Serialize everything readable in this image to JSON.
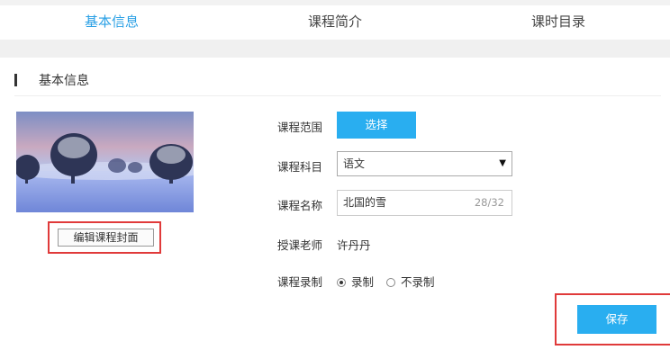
{
  "tabs": [
    {
      "label": "基本信息",
      "active": true
    },
    {
      "label": "课程简介",
      "active": false
    },
    {
      "label": "课时目录",
      "active": false
    }
  ],
  "section": {
    "title": "基本信息"
  },
  "cover": {
    "edit_label": "编辑课程封面"
  },
  "form": {
    "range_label": "课程范围",
    "range_button": "选择",
    "subject_label": "课程科目",
    "subject_value": "语文",
    "name_label": "课程名称",
    "name_value": "北国的雪",
    "name_counter": "28/32",
    "teacher_label": "授课老师",
    "teacher_value": "许丹丹",
    "record_label": "课程录制",
    "record_options": [
      "录制",
      "不录制"
    ],
    "record_selected": "录制"
  },
  "actions": {
    "save_label": "保存"
  },
  "colors": {
    "accent": "#29aef0",
    "highlight": "#e03a3a"
  }
}
